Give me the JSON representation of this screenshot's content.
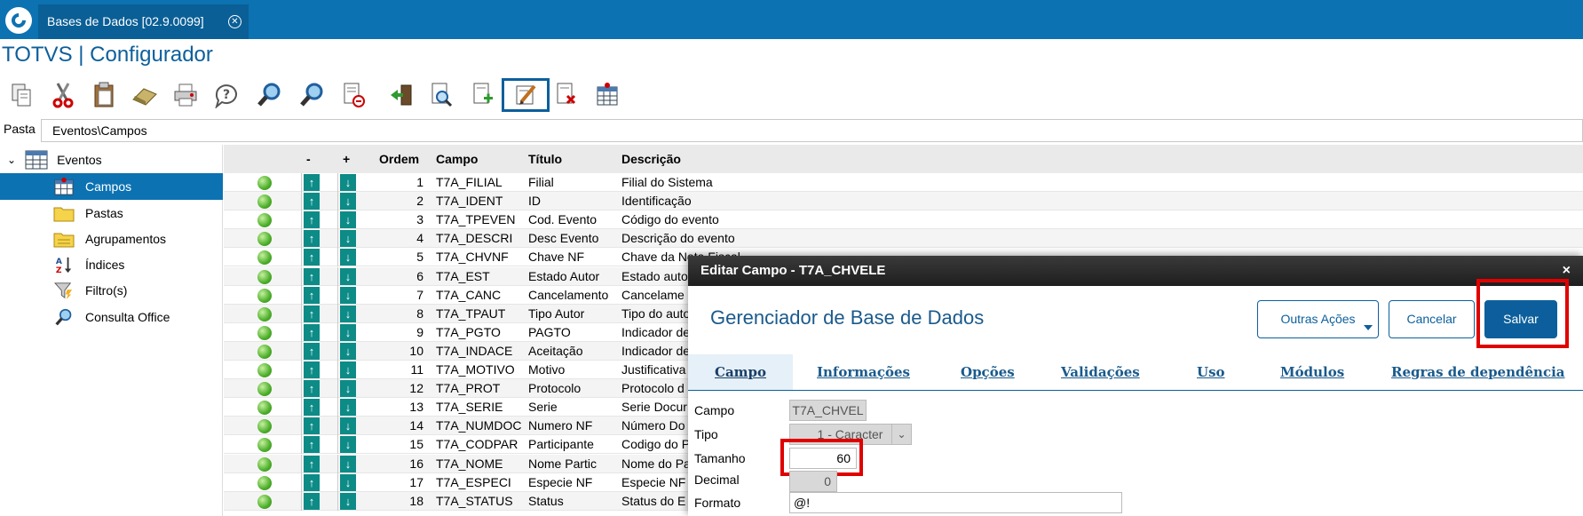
{
  "app": {
    "tab_title": "Bases de Dados [02.9.0099]",
    "tab_close": "✕",
    "title": "TOTVS | Configurador"
  },
  "toolbar": {
    "icons": [
      "copy-icon",
      "cut-icon",
      "paste-icon",
      "eraser-icon",
      "print-icon",
      "help-icon",
      "search-icon",
      "search-next-icon",
      "delete-record-icon",
      "export-icon",
      "preview-icon",
      "add-field-icon",
      "edit-field-icon",
      "remove-field-icon",
      "table-icon"
    ],
    "active": "edit-field-icon"
  },
  "path": {
    "label": "Pasta",
    "value": "Eventos\\Campos"
  },
  "tree": {
    "root": "Eventos",
    "items": [
      {
        "label": "Campos",
        "selected": true,
        "icon": "table-icon"
      },
      {
        "label": "Pastas",
        "selected": false,
        "icon": "folder-icon"
      },
      {
        "label": "Agrupamentos",
        "selected": false,
        "icon": "group-folder-icon"
      },
      {
        "label": "Índices",
        "selected": false,
        "icon": "sort-az-icon"
      },
      {
        "label": "Filtro(s)",
        "selected": false,
        "icon": "filter-icon"
      },
      {
        "label": "Consulta Office",
        "selected": false,
        "icon": "magnifier-icon"
      }
    ]
  },
  "grid": {
    "headers": {
      "minus": "-",
      "plus": "+",
      "ordem": "Ordem",
      "campo": "Campo",
      "titulo": "Título",
      "descricao": "Descrição"
    },
    "rows": [
      {
        "ordem": "1",
        "campo": "T7A_FILIAL",
        "titulo": "Filial",
        "descricao": "Filial do Sistema"
      },
      {
        "ordem": "2",
        "campo": "T7A_IDENT",
        "titulo": "ID",
        "descricao": "Identificação"
      },
      {
        "ordem": "3",
        "campo": "T7A_TPEVEN",
        "titulo": "Cod. Evento",
        "descricao": "Código do evento"
      },
      {
        "ordem": "4",
        "campo": "T7A_DESCRI",
        "titulo": "Desc Evento",
        "descricao": "Descrição do evento"
      },
      {
        "ordem": "5",
        "campo": "T7A_CHVNF",
        "titulo": "Chave NF",
        "descricao": "Chave da Nota Fiscal"
      },
      {
        "ordem": "6",
        "campo": "T7A_EST",
        "titulo": "Estado Autor",
        "descricao": "Estado auto"
      },
      {
        "ordem": "7",
        "campo": "T7A_CANC",
        "titulo": "Cancelamento",
        "descricao": "Cancelame"
      },
      {
        "ordem": "8",
        "campo": "T7A_TPAUT",
        "titulo": "Tipo Autor",
        "descricao": "Tipo do auto"
      },
      {
        "ordem": "9",
        "campo": "T7A_PGTO",
        "titulo": "PAGTO",
        "descricao": "Indicador de"
      },
      {
        "ordem": "10",
        "campo": "T7A_INDACE",
        "titulo": "Aceitação",
        "descricao": "Indicador de"
      },
      {
        "ordem": "11",
        "campo": "T7A_MOTIVO",
        "titulo": "Motivo",
        "descricao": "Justificativa"
      },
      {
        "ordem": "12",
        "campo": "T7A_PROT",
        "titulo": "Protocolo",
        "descricao": "Protocolo d"
      },
      {
        "ordem": "13",
        "campo": "T7A_SERIE",
        "titulo": "Serie",
        "descricao": "Serie Docur"
      },
      {
        "ordem": "14",
        "campo": "T7A_NUMDOC",
        "titulo": "Numero NF",
        "descricao": "Número Do"
      },
      {
        "ordem": "15",
        "campo": "T7A_CODPAR",
        "titulo": "Participante",
        "descricao": "Codigo do P"
      },
      {
        "ordem": "16",
        "campo": "T7A_NOME",
        "titulo": "Nome Partic",
        "descricao": "Nome do Pa"
      },
      {
        "ordem": "17",
        "campo": "T7A_ESPECI",
        "titulo": "Especie NF",
        "descricao": "Especie NF"
      },
      {
        "ordem": "18",
        "campo": "T7A_STATUS",
        "titulo": "Status",
        "descricao": "Status do E"
      }
    ]
  },
  "modal": {
    "header": "Editar Campo - T7A_CHVELE",
    "close": "×",
    "title": "Gerenciador de Base de Dados",
    "buttons": {
      "outras": "Outras Ações",
      "cancelar": "Cancelar",
      "salvar": "Salvar"
    },
    "tabs": [
      "Campo",
      "Informações",
      "Opções",
      "Validações",
      "Uso",
      "Módulos",
      "Regras de dependência"
    ],
    "fields": {
      "campo": {
        "label": "Campo",
        "value": "T7A_CHVEL"
      },
      "tipo": {
        "label": "Tipo",
        "value": "1 - Caracter"
      },
      "tamanho": {
        "label": "Tamanho",
        "value": "60"
      },
      "decimal": {
        "label": "Decimal",
        "value": "0"
      },
      "formato": {
        "label": "Formato",
        "value": "@!"
      }
    }
  },
  "colors": {
    "brand": "#0c72b2",
    "accent": "#0c5f9c",
    "highlight": "#e00000",
    "teal": "#0d8b86"
  }
}
